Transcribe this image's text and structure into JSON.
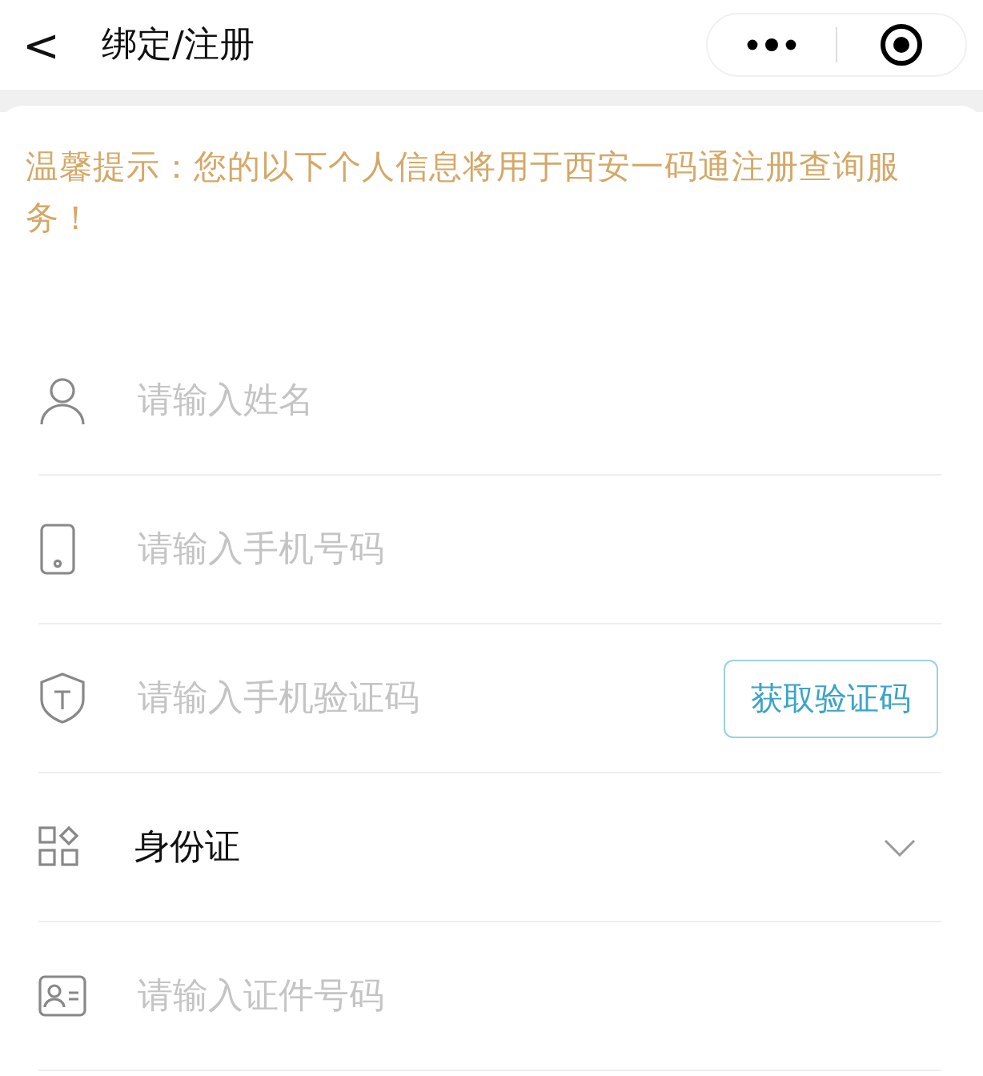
{
  "header": {
    "back": "<",
    "title": "绑定/注册"
  },
  "notice": "温馨提示：您的以下个人信息将用于西安一码通注册查询服务！",
  "fields": [
    {
      "kind": "input",
      "placeholder": "请输入姓名"
    },
    {
      "kind": "input",
      "placeholder": "请输入手机号码"
    },
    {
      "kind": "input",
      "placeholder": "请输入手机验证码",
      "button": "获取验证码"
    },
    {
      "kind": "select",
      "value": "身份证"
    },
    {
      "kind": "input",
      "placeholder": "请输入证件号码"
    }
  ]
}
